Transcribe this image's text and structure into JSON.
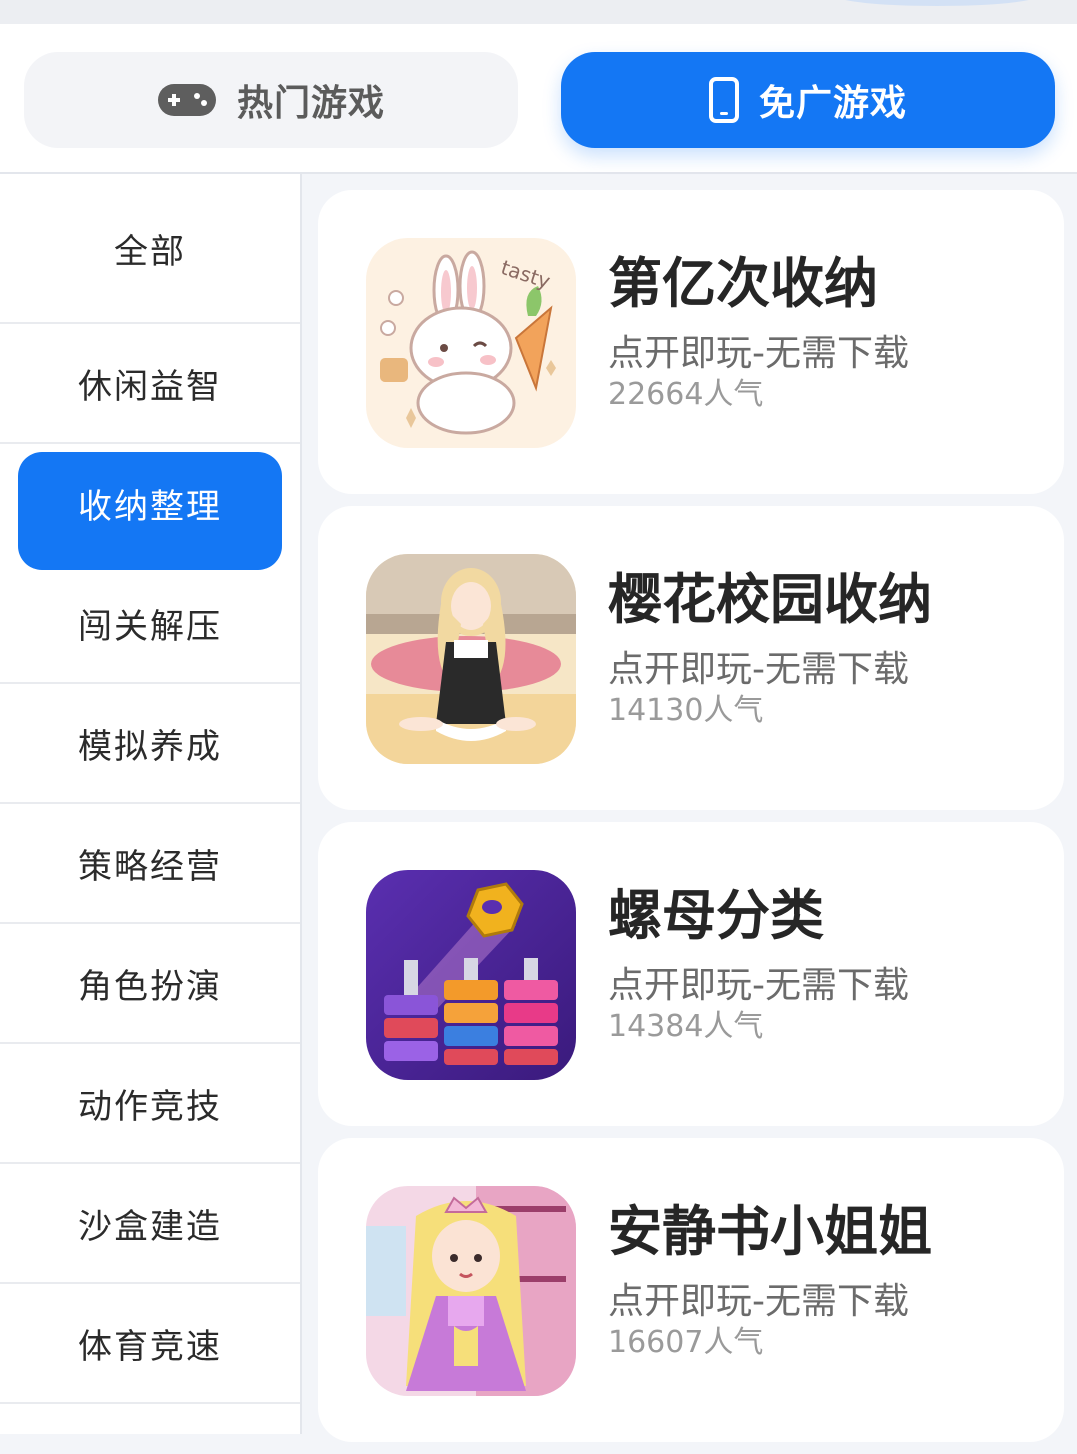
{
  "tabs": [
    {
      "label": "热门游戏",
      "icon": "gamepad-icon",
      "active": false
    },
    {
      "label": "免广游戏",
      "icon": "phone-icon",
      "active": true
    }
  ],
  "colors": {
    "accent": "#1477f4",
    "background": "#f3f5f9",
    "card": "#ffffff",
    "text": "#2b2b2b",
    "muted": "#9a9a9a"
  },
  "categories": [
    {
      "label": "全部",
      "active": false
    },
    {
      "label": "休闲益智",
      "active": false
    },
    {
      "label": "收纳整理",
      "active": true
    },
    {
      "label": "闯关解压",
      "active": false
    },
    {
      "label": "模拟养成",
      "active": false
    },
    {
      "label": "策略经营",
      "active": false
    },
    {
      "label": "角色扮演",
      "active": false
    },
    {
      "label": "动作竞技",
      "active": false
    },
    {
      "label": "沙盒建造",
      "active": false
    },
    {
      "label": "体育竞速",
      "active": false
    }
  ],
  "games": [
    {
      "title": "第亿次收纳",
      "subtitle": "点开即玩-无需下载",
      "popularity": "22664人气",
      "icon": "bunny-game-icon"
    },
    {
      "title": "樱花校园收纳",
      "subtitle": "点开即玩-无需下载",
      "popularity": "14130人气",
      "icon": "girl-game-icon"
    },
    {
      "title": "螺母分类",
      "subtitle": "点开即玩-无需下载",
      "popularity": "14384人气",
      "icon": "nut-sort-game-icon"
    },
    {
      "title": "安静书小姐姐",
      "subtitle": "点开即玩-无需下载",
      "popularity": "16607人气",
      "icon": "princess-game-icon"
    }
  ]
}
